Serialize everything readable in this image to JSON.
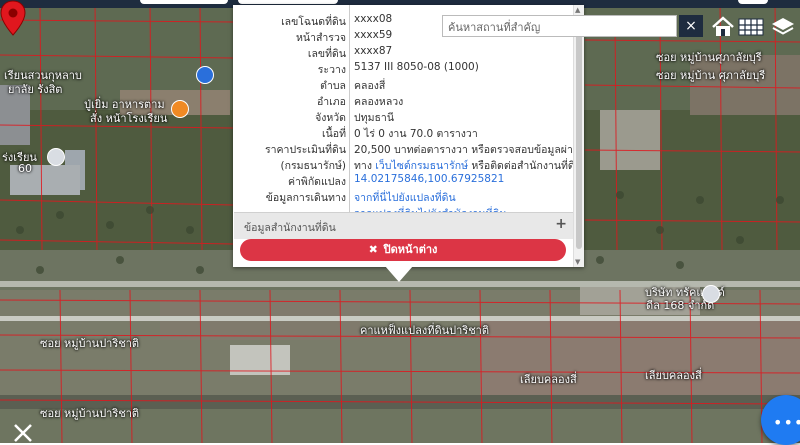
{
  "parcel_popup": {
    "rows": [
      {
        "label": "เลขโฉนดที่ดิน",
        "value": "xxxx08"
      },
      {
        "label": "หน้าสำรวจ",
        "value": "xxxx59"
      },
      {
        "label": "เลขที่ดิน",
        "value": "xxxx87"
      },
      {
        "label": "ระวาง",
        "value": "5137 III 8050-08 (1000)"
      },
      {
        "label": "ตำบล",
        "value": "คลองสี่"
      },
      {
        "label": "อำเภอ",
        "value": "คลองหลวง"
      },
      {
        "label": "จังหวัด",
        "value": "ปทุมธานี"
      },
      {
        "label": "เนื้อที่",
        "value": "0 ไร่ 0 งาน 70.0 ตารางวา"
      },
      {
        "label": "ราคาประเมินที่ดิน",
        "value": "20,500 บาทต่อตารางวา หรือตรวจสอบข้อมูลผ่าน"
      },
      {
        "label": "(กรมธนารักษ์)",
        "value_prefix": "ทาง",
        "value_link": "เว็บไซต์กรมธนารักษ์",
        "value_suffix": "หรือติดต่อสำนักงานที่ดิน"
      },
      {
        "label": "ค่าพิกัดแปลง",
        "value_link": "14.02175846,100.67925821"
      },
      {
        "label": "ข้อมูลการเดินทาง",
        "value_link": "จากที่นี่ไปยังแปลงที่ดิน"
      },
      {
        "label": "",
        "value_link": "จากแปลงที่ดินไปยังสำนักงานที่ดิน"
      }
    ],
    "section_title": "ข้อมูลสำนักงานที่ดิน",
    "section_icon": "plus-icon",
    "close_label": "ปิดหน้าต่าง",
    "close_icon": "close-x-icon"
  },
  "search": {
    "placeholder": "ค้นหาสถานที่สำคัญ",
    "clear_label": "×"
  },
  "toolbar": {
    "icons": [
      "home-icon",
      "grid-table-icon",
      "layers-icon"
    ]
  },
  "map_labels": [
    {
      "text": "ซอย หมู่บ้านศุภาลัยบุรี",
      "name": "street-label-supalai-1"
    },
    {
      "text": "ซอย หมู่บ้าน ศุภาลัยบุรี",
      "name": "street-label-supalai-2"
    },
    {
      "text": "บริษัท ทรัคแอนด์",
      "name": "place-label-truck"
    },
    {
      "text": "ดีล 168 จำกัด",
      "name": "place-label-deal-168"
    },
    {
      "text": "ซอย หมู่บ้านปาริชาติ",
      "name": "street-label-parichat-1"
    },
    {
      "text": "ซอย หมู่บ้านปาริชาติ",
      "name": "street-label-parichat-2"
    },
    {
      "text": "เลียบคลองสี่",
      "name": "street-label-liap-khlong-4-a"
    },
    {
      "text": "เลียบคลองสี่",
      "name": "street-label-liap-khlong-4-b"
    },
    {
      "text": "คาแหฟ็งแปลงที่ดินปาริชาติ",
      "name": "place-label-parcel"
    },
    {
      "text": "เรียนสวนกุหลาบ",
      "name": "place-label-school"
    },
    {
      "text": "ยาลัย รังสิต",
      "name": "place-label-rangsit"
    },
    {
      "text": "ปู่เยิ่ม อาหารตาม",
      "name": "place-label-restaurant"
    },
    {
      "text": "สั่ง หน้าโรงเรียน",
      "name": "place-label-restaurant-2"
    },
    {
      "text": "ร่งเรียน",
      "name": "place-label-school-2"
    },
    {
      "text": "60",
      "name": "place-label-60"
    }
  ],
  "colors": {
    "accent": "#1e2c3f",
    "close": "#dc3545",
    "link": "#2a6fdb",
    "fab": "#1f7bf2",
    "pin": "#e0171e"
  }
}
